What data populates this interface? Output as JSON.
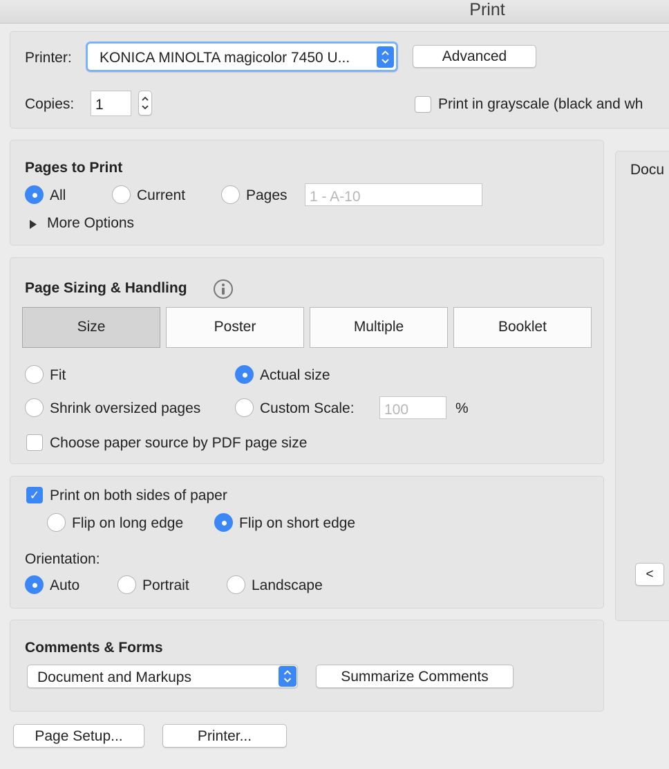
{
  "window": {
    "title": "Print"
  },
  "printer": {
    "label": "Printer:",
    "selected": "KONICA MINOLTA magicolor 7450 U...",
    "advanced_label": "Advanced",
    "copies_label": "Copies:",
    "copies_value": "1",
    "grayscale_label": "Print in grayscale (black and wh",
    "grayscale_checked": false
  },
  "pages_to_print": {
    "heading": "Pages to Print",
    "all_label": "All",
    "current_label": "Current",
    "pages_label": "Pages",
    "pages_placeholder": "1 - A-10",
    "selected": "All",
    "more_options_label": "More Options"
  },
  "sizing": {
    "heading": "Page Sizing & Handling",
    "tabs": [
      "Size",
      "Poster",
      "Multiple",
      "Booklet"
    ],
    "active_tab": "Size",
    "fit_label": "Fit",
    "actual_size_label": "Actual size",
    "shrink_label": "Shrink oversized pages",
    "custom_scale_label": "Custom Scale:",
    "custom_scale_value": "100",
    "percent_sign": "%",
    "selected": "Actual size",
    "paper_source_label": "Choose paper source by PDF page size",
    "paper_source_checked": false
  },
  "duplex": {
    "both_sides_label": "Print on both sides of paper",
    "both_sides_checked": true,
    "long_edge_label": "Flip on long edge",
    "short_edge_label": "Flip on short edge",
    "flip_selected": "Flip on short edge",
    "orientation_label": "Orientation:",
    "auto_label": "Auto",
    "portrait_label": "Portrait",
    "landscape_label": "Landscape",
    "orientation_selected": "Auto"
  },
  "comments": {
    "heading": "Comments & Forms",
    "selected": "Document and Markups",
    "summarize_label": "Summarize Comments"
  },
  "footer": {
    "page_setup_label": "Page Setup...",
    "printer_label": "Printer..."
  },
  "preview": {
    "heading": "Docu",
    "prev_label": "<"
  },
  "colors": {
    "accent": "#3a87f5",
    "panel": "#e6e6e6",
    "background": "#ececec"
  }
}
